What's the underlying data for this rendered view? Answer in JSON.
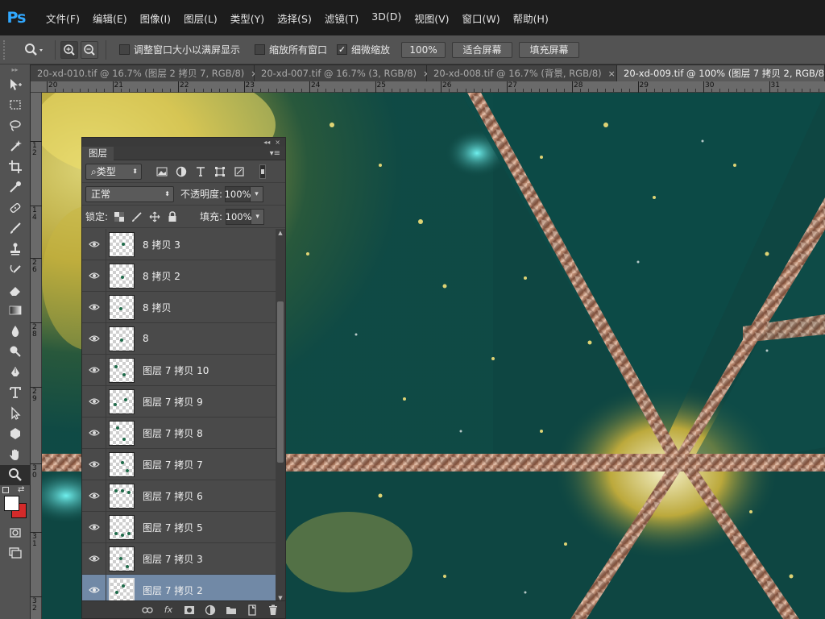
{
  "app": {
    "logo_text": "Ps",
    "accent_color": "#31a8ff"
  },
  "menu": [
    {
      "label": "文件(F)"
    },
    {
      "label": "编辑(E)"
    },
    {
      "label": "图像(I)"
    },
    {
      "label": "图层(L)"
    },
    {
      "label": "类型(Y)"
    },
    {
      "label": "选择(S)"
    },
    {
      "label": "滤镜(T)"
    },
    {
      "label": "3D(D)"
    },
    {
      "label": "视图(V)"
    },
    {
      "label": "窗口(W)"
    },
    {
      "label": "帮助(H)"
    }
  ],
  "options": {
    "tool_icon": "zoom-icon",
    "resize_windows_label": "调整窗口大小以满屏显示",
    "resize_windows_checked": false,
    "zoom_all_label": "缩放所有窗口",
    "zoom_all_checked": false,
    "scrubby_zoom_label": "细微缩放",
    "scrubby_zoom_checked": true,
    "btn_100": "100%",
    "btn_fit": "适合屏幕",
    "btn_fill": "填充屏幕"
  },
  "tabs": [
    {
      "label": "20-xd-010.tif @ 16.7% (图层 2 拷贝 7, RGB/8)",
      "active": false
    },
    {
      "label": "20-xd-007.tif @ 16.7% (3, RGB/8)",
      "active": false
    },
    {
      "label": "20-xd-008.tif @ 16.7% (背景, RGB/8)",
      "active": false
    },
    {
      "label": "20-xd-009.tif @ 100% (图层 7 拷贝 2, RGB/8)",
      "active": true
    }
  ],
  "tab_close": "×",
  "ruler": {
    "h_labels": [
      "20",
      "21",
      "22",
      "23",
      "24",
      "25",
      "26",
      "27",
      "28",
      "29",
      "30",
      "31",
      "32"
    ],
    "v_labels": [
      "1 2",
      "1 4",
      "2 6",
      "2 8",
      "2 9",
      "3 0",
      "3 1",
      "3 2"
    ]
  },
  "layers_panel": {
    "collapse_glyph": "◂◂",
    "close_glyph": "×",
    "tab_label": "图层",
    "menu_glyph": "▾≡",
    "filter_label": "类型",
    "blend_mode": "正常",
    "opacity_label": "不透明度:",
    "opacity_value": "100%",
    "lock_label": "锁定:",
    "fill_label": "填充:",
    "fill_value": "100%",
    "layers": [
      {
        "name": "8 拷贝 3",
        "visible": true,
        "selected": false
      },
      {
        "name": "8 拷贝 2",
        "visible": true,
        "selected": false
      },
      {
        "name": "8 拷贝",
        "visible": true,
        "selected": false
      },
      {
        "name": "8",
        "visible": true,
        "selected": false
      },
      {
        "name": "图层 7 拷贝 10",
        "visible": true,
        "selected": false
      },
      {
        "name": "图层 7 拷贝 9",
        "visible": true,
        "selected": false
      },
      {
        "name": "图层 7 拷贝 8",
        "visible": true,
        "selected": false
      },
      {
        "name": "图层 7 拷贝 7",
        "visible": true,
        "selected": false
      },
      {
        "name": "图层 7 拷贝 6",
        "visible": true,
        "selected": false
      },
      {
        "name": "图层 7 拷贝 5",
        "visible": true,
        "selected": false
      },
      {
        "name": "图层 7 拷贝 3",
        "visible": true,
        "selected": false
      },
      {
        "name": "图层 7 拷贝 2",
        "visible": true,
        "selected": true
      }
    ],
    "bottom_icons": [
      "link-icon",
      "fx-icon",
      "mask-icon",
      "adjustment-icon",
      "folder-icon",
      "new-layer-icon",
      "trash-icon"
    ],
    "fx_label": "fx"
  },
  "colors": {
    "canvas_teal": "#0f4a45",
    "rose_gold": "#b7846a",
    "gold": "#e5c640",
    "selection": "#7189a6"
  }
}
